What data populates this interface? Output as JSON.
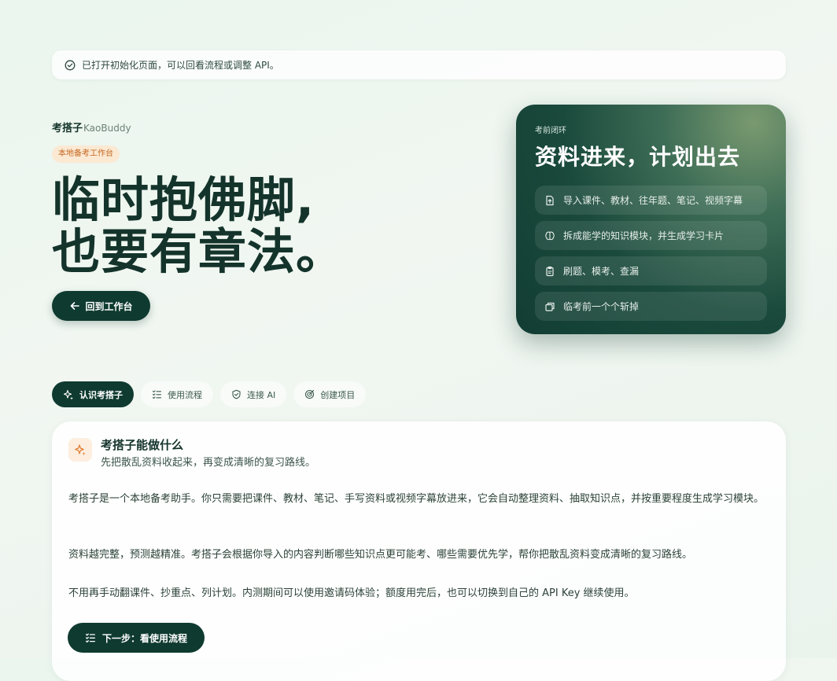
{
  "notice": {
    "text": "已打开初始化页面，可以回看流程或调整 API。"
  },
  "brand": {
    "name_zh": "考搭子",
    "name_en": "KaoBuddy"
  },
  "tag": "本地备考工作台",
  "hero": {
    "line1": "临时抱佛脚,",
    "line2": "也要有章法。"
  },
  "back_button": "回到工作台",
  "card": {
    "eyebrow": "考前闭环",
    "title": "资料进来，计划出去",
    "items": [
      {
        "icon": "file-upload-icon",
        "label": "导入课件、教材、往年题、笔记、视频字幕"
      },
      {
        "icon": "brain-icon",
        "label": "拆成能学的知识模块，并生成学习卡片"
      },
      {
        "icon": "clipboard-icon",
        "label": "刷题、模考、查漏"
      },
      {
        "icon": "layers-icon",
        "label": "临考前一个个斩掉"
      }
    ]
  },
  "tabs": [
    {
      "icon": "sparkle-icon",
      "label": "认识考搭子",
      "active": true
    },
    {
      "icon": "checklist-icon",
      "label": "使用流程",
      "active": false
    },
    {
      "icon": "shield-icon",
      "label": "连接 AI",
      "active": false
    },
    {
      "icon": "target-icon",
      "label": "创建项目",
      "active": false
    }
  ],
  "panel": {
    "title": "考搭子能做什么",
    "subtitle": "先把散乱资料收起来，再变成清晰的复习路线。",
    "paragraphs": [
      "考搭子是一个本地备考助手。你只需要把课件、教材、笔记、手写资料或视频字幕放进来，它会自动整理资料、抽取知识点，并按重要程度生成学习模块。",
      "资料越完整，预测越精准。考搭子会根据你导入的内容判断哪些知识点更可能考、哪些需要优先学，帮你把散乱资料变成清晰的复习路线。",
      "不用再手动翻课件、抄重点、列计划。内测期间可以使用邀请码体验；额度用完后，也可以切换到自己的 API Key 继续使用。"
    ],
    "next_button": "下一步：看使用流程"
  },
  "colors": {
    "primary": "#0f3a30",
    "accent": "#e07a2e",
    "tag_bg": "#fbe9d3"
  }
}
